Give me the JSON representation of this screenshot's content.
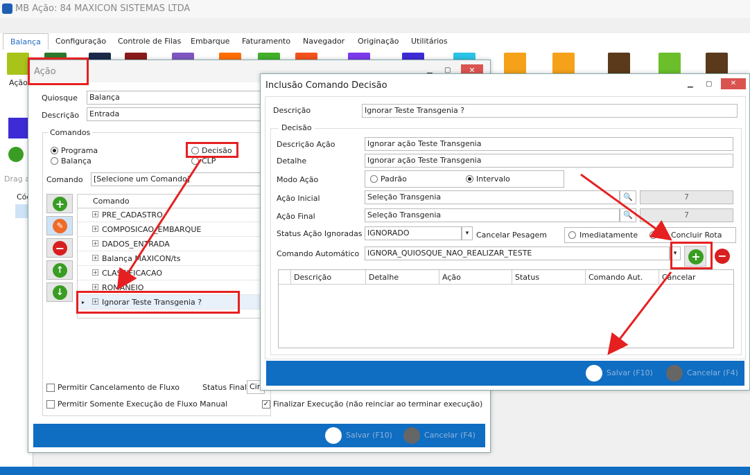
{
  "app": {
    "title": "MB Ação: 84 MAXICON SISTEMAS LTDA"
  },
  "ribbon": {
    "tabs": [
      "Balança",
      "Configuração",
      "Controle de Filas",
      "Embarque",
      "Faturamento",
      "Navegador",
      "Originação",
      "Utilitários"
    ],
    "first_button_label": "Ação"
  },
  "background": {
    "drag_hint": "Drag a",
    "col_header": "Cód"
  },
  "acao_window": {
    "title": "Ação",
    "quiosque_label": "Quiosque",
    "quiosque_value": "Balança",
    "descricao_label": "Descrição",
    "descricao_value": "Entrada",
    "comandos_group": "Comandos",
    "radio_programa": "Programa",
    "radio_balanca": "Balança",
    "radio_decisao": "Decisão",
    "radio_clp": "CLP",
    "comando_label": "Comando",
    "comando_value": "[Selecione um Comando]",
    "tree_header": "Comando",
    "tree_items": [
      "PRE_CADASTRO",
      "COMPOSICAO_EMBARQUE",
      "DADOS_ENTRADA",
      "Balança MAXICON/ts",
      "CLASSIFICACAO",
      "ROMANEIO",
      "Ignorar Teste Transgenia ?"
    ],
    "chk_cancelamento": "Permitir Cancelamento de Fluxo",
    "status_final_label": "Status Final",
    "status_final_value": "Cir",
    "chk_manual": "Permitir Somente Execução de Fluxo Manual",
    "chk_finalizar": "Finalizar Execução (não reinciar ao terminar execução)",
    "salvar": "Salvar (F10)",
    "cancelar": "Cancelar (F4)"
  },
  "dialog": {
    "title": "Inclusão Comando Decisão",
    "descricao_label": "Descrição",
    "descricao_value": "Ignorar Teste Transgenia ?",
    "decisao_group": "Decisão",
    "descricao_acao_label": "Descrição Ação",
    "descricao_acao_value": "Ignorar ação Teste Transgenia",
    "detalhe_label": "Detalhe",
    "detalhe_value": "Ignorar ação Teste Transgenia",
    "modo_acao_label": "Modo Ação",
    "modo_padrao": "Padrão",
    "modo_intervalo": "Intervalo",
    "acao_inicial_label": "Ação Inicial",
    "acao_inicial_value": "Seleção Transgenia",
    "acao_inicial_num": "7",
    "acao_final_label": "Ação Final",
    "acao_final_value": "Seleção Transgenia",
    "acao_final_num": "7",
    "status_ignoradas_label": "Status Ação Ignoradas",
    "status_ignoradas_value": "IGNORADO",
    "cancelar_pesagem_label": "Cancelar Pesagem",
    "imediatamente": "Imediatamente",
    "concluir_rota": "Concluir Rota",
    "comando_auto_label": "Comando Automático",
    "comando_auto_value": "IGNORA_QUIOSQUE_NAO_REALIZAR_TESTE",
    "grid_headers": [
      "Descrição",
      "Detalhe",
      "Ação",
      "Status",
      "Comando Aut.",
      "Cancelar"
    ],
    "salvar": "Salvar (F10)",
    "cancelar": "Cancelar (F4)"
  },
  "colors": {
    "accent_blue": "#0f6dc2",
    "highlight_red": "#e62020",
    "green": "#3a9d23",
    "red": "#d81f1f"
  }
}
